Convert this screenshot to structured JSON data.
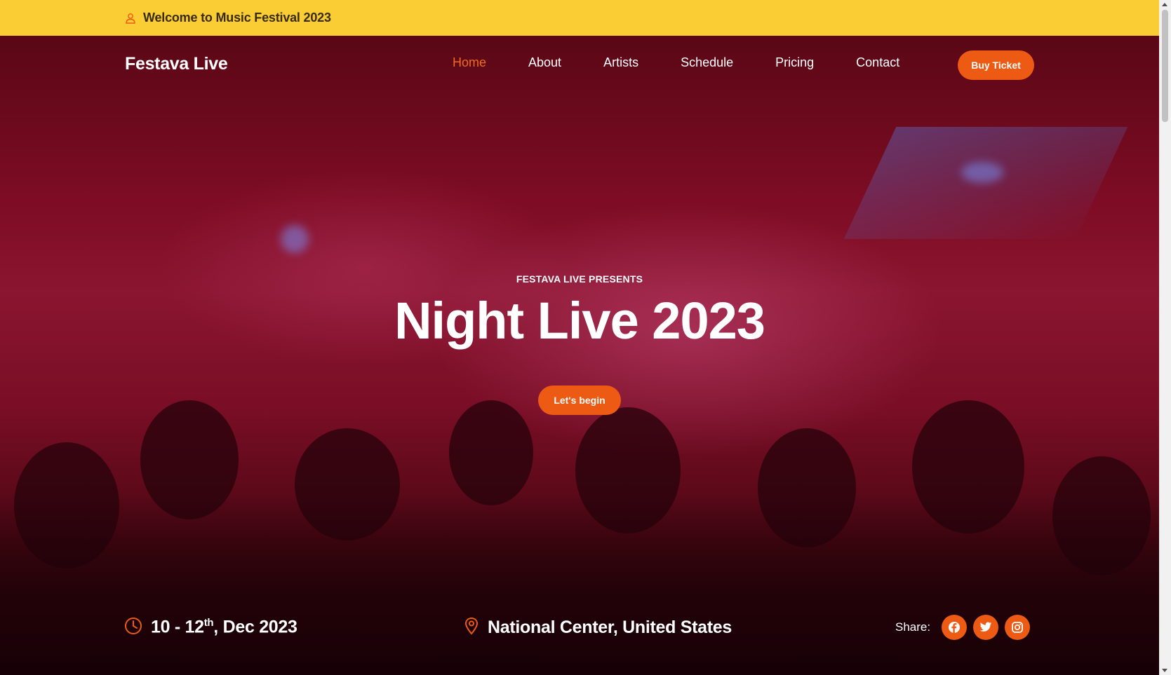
{
  "topbar": {
    "welcome_text": "Welcome to Music Festival 2023",
    "icon": "user-icon"
  },
  "nav": {
    "brand": "Festava Live",
    "items": [
      {
        "label": "Home",
        "active": true
      },
      {
        "label": "About",
        "active": false
      },
      {
        "label": "Artists",
        "active": false
      },
      {
        "label": "Schedule",
        "active": false
      },
      {
        "label": "Pricing",
        "active": false
      },
      {
        "label": "Contact",
        "active": false
      }
    ],
    "buy_ticket_label": "Buy Ticket"
  },
  "hero": {
    "presents": "FESTAVA LIVE PRESENTS",
    "title": "Night Live 2023",
    "cta_label": "Let's begin"
  },
  "info": {
    "date_prefix": "10 - 12",
    "date_sup": "th",
    "date_suffix": ", Dec 2023",
    "location": "National Center, United States",
    "share_label": "Share:",
    "social": [
      "facebook-icon",
      "twitter-icon",
      "instagram-icon"
    ]
  },
  "colors": {
    "topbar_bg": "#f9cd33",
    "accent": "#ec5a13",
    "active_nav": "#f16a22",
    "hero_tint": "#7e0c24"
  }
}
